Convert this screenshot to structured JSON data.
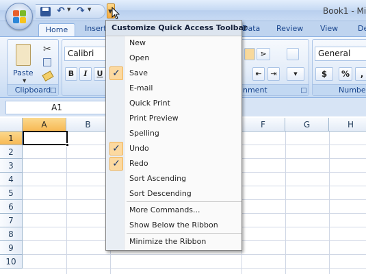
{
  "window": {
    "title": "Book1 - Mic"
  },
  "qat_menu": {
    "header": "Customize Quick Access Toolbar",
    "items": [
      {
        "label": "New",
        "checked": false
      },
      {
        "label": "Open",
        "checked": false
      },
      {
        "label": "Save",
        "checked": true
      },
      {
        "label": "E-mail",
        "checked": false
      },
      {
        "label": "Quick Print",
        "checked": false
      },
      {
        "label": "Print Preview",
        "checked": false
      },
      {
        "label": "Spelling",
        "checked": false
      },
      {
        "label": "Undo",
        "checked": true
      },
      {
        "label": "Redo",
        "checked": true
      },
      {
        "label": "Sort Ascending",
        "checked": false
      },
      {
        "label": "Sort Descending",
        "checked": false
      },
      {
        "label": "More Commands...",
        "checked": false
      },
      {
        "label": "Show Below the Ribbon",
        "checked": false
      },
      {
        "label": "Minimize the Ribbon",
        "checked": false
      }
    ],
    "check_glyph": "✓"
  },
  "ribbon": {
    "tabs": [
      "Home",
      "Insert",
      "Data",
      "Review",
      "View",
      "De"
    ],
    "clipboard": {
      "paste_label": "Paste",
      "group_label": "Clipboard"
    },
    "font": {
      "name": "Calibri",
      "bold": "B",
      "italic": "I",
      "underline": "U"
    },
    "alignment": {
      "group_label_partial": "nment"
    },
    "number": {
      "format": "General",
      "currency": "$",
      "percent": "%",
      "group_label_partial": "Numbe"
    }
  },
  "formula_bar": {
    "name_box": "A1"
  },
  "grid": {
    "columns": [
      "A",
      "B",
      "F",
      "G",
      "H"
    ],
    "rows": [
      "1",
      "2",
      "3",
      "4",
      "5",
      "6",
      "7",
      "8",
      "9",
      "10"
    ],
    "active_cell": "A1"
  },
  "colors": {
    "accent": "#f7b955",
    "ribbon": "#dbe7f7",
    "check_bg": "#fcd9a0"
  }
}
